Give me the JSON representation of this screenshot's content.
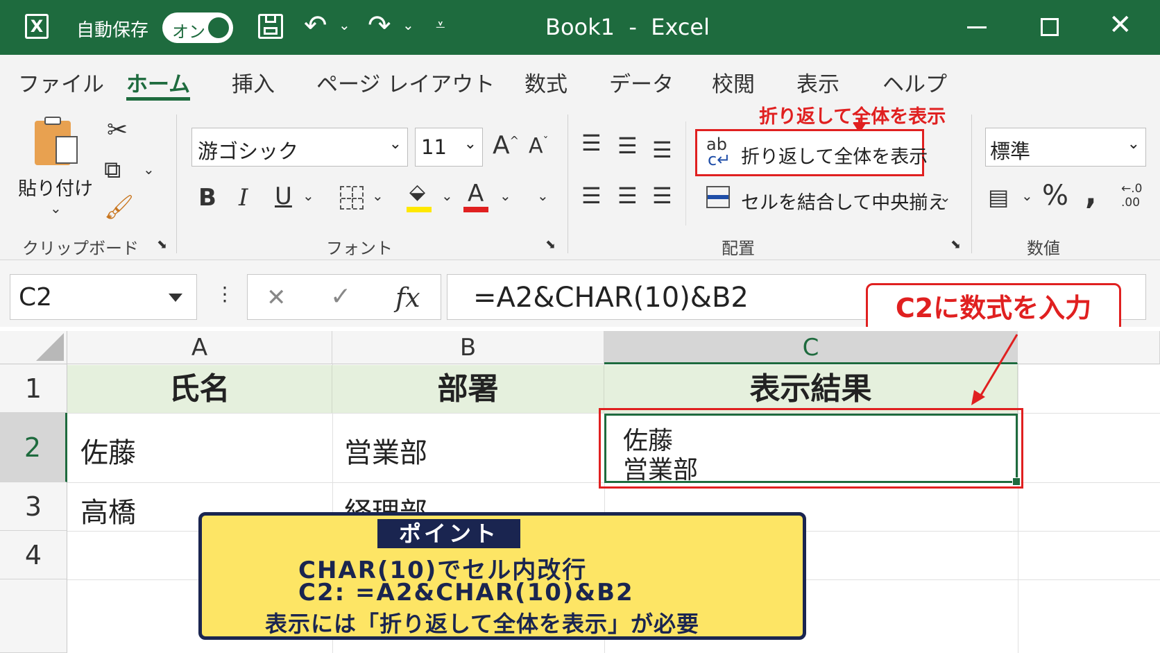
{
  "titlebar": {
    "autosave_label": "自動保存",
    "autosave_toggle": "オン",
    "title": "Book1  -  Excel",
    "app_icon": "excel-icon",
    "bg_color": "#1e6b3e"
  },
  "tabs": [
    "ファイル",
    "ホーム",
    "挿入",
    "ページ レイアウト",
    "数式",
    "データ",
    "校閲",
    "表示",
    "ヘルプ"
  ],
  "active_tab": "ホーム",
  "ribbon": {
    "clipboard": {
      "paste_label": "貼り付け",
      "group_label": "クリップボード"
    },
    "font": {
      "font_name": "游ゴシック",
      "font_size": "11",
      "group_label": "フォント",
      "bold": "B",
      "italic": "I",
      "underline": "U",
      "grow": "A",
      "shrink": "A",
      "font_color_glyph": "A"
    },
    "alignment": {
      "wrap_text_label": "折り返して全体を表示",
      "wrap_icon_glyph": "ab",
      "merge_label": "セルを結合して中央揃え",
      "group_label": "配置"
    },
    "number": {
      "format": "標準",
      "group_label": "数値",
      "percent": "%",
      "comma": "❟",
      "decimal_inc": "←.0\n.00"
    },
    "annotation_wrap": "折り返して全体を表示"
  },
  "formula_bar": {
    "name_box": "C2",
    "cancel": "✕",
    "enter": "✓",
    "fx": "fx",
    "formula": "=A2&CHAR(10)&B2"
  },
  "callout_c2": "C2に数式を入力",
  "columns": [
    "A",
    "B",
    "C"
  ],
  "rows": [
    "1",
    "2",
    "3",
    "4"
  ],
  "cells": {
    "A1": "氏名",
    "B1": "部署",
    "C1": "表示結果",
    "A2": "佐藤",
    "B2": "営業部",
    "C2_line1": "佐藤",
    "C2_line2": "営業部",
    "A3": "高橋",
    "B3": "経理部"
  },
  "point_box": {
    "title": "ポイント",
    "line1": "CHAR(10)でセル内改行",
    "line2": "C2: =A2&CHAR(10)&B2",
    "line3": "表示には「折り返して全体を表示」が必要"
  },
  "colors": {
    "accent": "#1e6b3e",
    "highlight_red": "#e02020",
    "header_fill": "#e5f0dd",
    "point_bg": "#fde565",
    "point_border": "#1a2550"
  }
}
